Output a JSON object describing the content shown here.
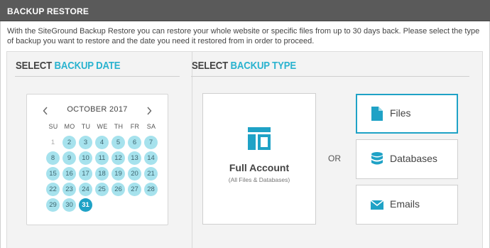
{
  "header": {
    "title": "BACKUP RESTORE"
  },
  "description": "With the SiteGround Backup Restore you can restore your whole website or specific files from up to 30 days back. Please select the type of backup you want to restore and the date you need it restored from in order to proceed.",
  "date_section": {
    "heading_plain": "SELECT",
    "heading_accent": "BACKUP DATE"
  },
  "type_section": {
    "heading_plain": "SELECT",
    "heading_accent": "BACKUP TYPE"
  },
  "calendar": {
    "month": "OCTOBER 2017",
    "prev_icon": "chevron-left-icon",
    "next_icon": "chevron-right-icon",
    "weekdays": [
      "SU",
      "MO",
      "TU",
      "WE",
      "TH",
      "FR",
      "SA"
    ],
    "days": [
      {
        "label": "1",
        "state": "disabled"
      },
      {
        "label": "2",
        "state": "available"
      },
      {
        "label": "3",
        "state": "available"
      },
      {
        "label": "4",
        "state": "available"
      },
      {
        "label": "5",
        "state": "available"
      },
      {
        "label": "6",
        "state": "available"
      },
      {
        "label": "7",
        "state": "available"
      },
      {
        "label": "8",
        "state": "available"
      },
      {
        "label": "9",
        "state": "available"
      },
      {
        "label": "10",
        "state": "available"
      },
      {
        "label": "11",
        "state": "available"
      },
      {
        "label": "12",
        "state": "available"
      },
      {
        "label": "13",
        "state": "available"
      },
      {
        "label": "14",
        "state": "available"
      },
      {
        "label": "15",
        "state": "available"
      },
      {
        "label": "16",
        "state": "available"
      },
      {
        "label": "17",
        "state": "available"
      },
      {
        "label": "18",
        "state": "available"
      },
      {
        "label": "19",
        "state": "available"
      },
      {
        "label": "20",
        "state": "available"
      },
      {
        "label": "21",
        "state": "available"
      },
      {
        "label": "22",
        "state": "available"
      },
      {
        "label": "23",
        "state": "available"
      },
      {
        "label": "24",
        "state": "available"
      },
      {
        "label": "25",
        "state": "available"
      },
      {
        "label": "26",
        "state": "available"
      },
      {
        "label": "27",
        "state": "available"
      },
      {
        "label": "28",
        "state": "available"
      },
      {
        "label": "29",
        "state": "available"
      },
      {
        "label": "30",
        "state": "available"
      },
      {
        "label": "31",
        "state": "selected"
      }
    ]
  },
  "full_account": {
    "title": "Full Account",
    "subtitle": "(All Files & Databases)",
    "icon": "layout-icon"
  },
  "or_label": "OR",
  "types": [
    {
      "label": "Files",
      "icon": "file-icon",
      "active": true
    },
    {
      "label": "Databases",
      "icon": "database-icon",
      "active": false
    },
    {
      "label": "Emails",
      "icon": "envelope-icon",
      "active": false
    }
  ],
  "colors": {
    "accent": "#1fa2c6",
    "heading_accent": "#2ab3cf",
    "available_day": "#a6e2ed",
    "titlebar": "#5a5a5a"
  }
}
